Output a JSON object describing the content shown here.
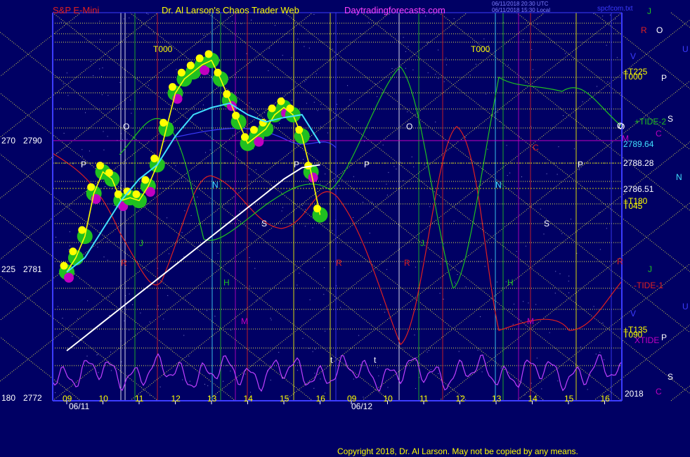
{
  "header": {
    "instrument": "S&P E-Mini",
    "site_title": "Dr. Al Larson's Chaos Trader Web",
    "url": "Daytradingforecasts.com",
    "timestamp1": "06/11/2018 20:30 UTC",
    "timestamp2": "06/11/2018 15:30 Local",
    "filename": "spcfcom.txt"
  },
  "copyright": "Copyright 2018, Dr. Al Larson. May not be copied by any means.",
  "colors": {
    "background": "#000064",
    "axis": "#3c3cff",
    "grid": "#ffff64",
    "price_line": "#ffff00",
    "ema_fast": "#40e0ff",
    "ema_slow": "#ffffff",
    "osc": "#c040ff",
    "red_tide": "#e02020",
    "green_tide": "#20c020",
    "bubble_green": "#20c020",
    "bubble_magenta": "#c000c0"
  },
  "left_axis": {
    "labels": [
      {
        "osc": "270",
        "price": "2790"
      },
      {
        "osc": "225",
        "price": "2781"
      },
      {
        "osc": "180",
        "price": "2772"
      }
    ]
  },
  "right_labels": [
    {
      "text": "J",
      "color": "#20c020"
    },
    {
      "text": "R",
      "color": "#e02020"
    },
    {
      "text": "O",
      "color": "#ffffff"
    },
    {
      "text": "U",
      "color": "#3c3cff"
    },
    {
      "text": "V",
      "color": "#3c3cff"
    },
    {
      "text": "+T225",
      "color": "#ffff00"
    },
    {
      "text": "T000",
      "color": "#ffff00"
    },
    {
      "text": "P",
      "color": "#ffffff"
    },
    {
      "text": "+TIDE-2",
      "color": "#20c020"
    },
    {
      "text": "S",
      "color": "#ffffff"
    },
    {
      "text": "O",
      "color": "#ffffff"
    },
    {
      "text": "C",
      "color": "#c000c0"
    },
    {
      "text": "M",
      "color": "#c000c0"
    },
    {
      "text": "2789.64",
      "color": "#40e0ff"
    },
    {
      "text": "2788.28",
      "color": "#ffffff"
    },
    {
      "text": "N",
      "color": "#40e0ff"
    },
    {
      "text": "2786.51",
      "color": "#ffffff"
    },
    {
      "text": "+T180",
      "color": "#ffff00"
    },
    {
      "text": "T045",
      "color": "#ffff00"
    },
    {
      "text": "R",
      "color": "#e02020"
    },
    {
      "text": "J",
      "color": "#20c020"
    },
    {
      "text": "-TIDE-1",
      "color": "#e02020"
    },
    {
      "text": "U",
      "color": "#3c3cff"
    },
    {
      "text": "V",
      "color": "#3c3cff"
    },
    {
      "text": "+T135",
      "color": "#ffff00"
    },
    {
      "text": "T090",
      "color": "#ffff00"
    },
    {
      "text": "P",
      "color": "#ffffff"
    },
    {
      "text": "XTIDE",
      "color": "#c000c0"
    },
    {
      "text": "S",
      "color": "#ffffff"
    },
    {
      "text": "2018",
      "color": "#ffffff"
    },
    {
      "text": "C",
      "color": "#c000c0"
    }
  ],
  "chart_data": {
    "type": "line",
    "title": "S&P E-Mini",
    "ylabel": "",
    "ylim": [
      2772,
      2797
    ],
    "dates": [
      "06/11",
      "06/12"
    ],
    "hour_ticks": [
      "09",
      "10",
      "11",
      "12",
      "13",
      "14",
      "15",
      "16",
      "09",
      "10",
      "11",
      "12",
      "13",
      "14",
      "15",
      "16"
    ],
    "price_labels": [
      "2790",
      "2781",
      "2772"
    ],
    "oscillator_labels": [
      "270",
      "225",
      "180"
    ],
    "markers": [
      {
        "text": "T000",
        "color": "#ffff00"
      },
      {
        "text": "T000",
        "color": "#ffff00"
      },
      {
        "text": "O",
        "color": "#ffffff"
      },
      {
        "text": "O",
        "color": "#ffffff"
      },
      {
        "text": "O",
        "color": "#ffffff"
      },
      {
        "text": "P",
        "color": "#ffffff"
      },
      {
        "text": "P",
        "color": "#ffffff"
      },
      {
        "text": "P",
        "color": "#ffffff"
      },
      {
        "text": "P",
        "color": "#ffffff"
      },
      {
        "text": "N",
        "color": "#40e0ff"
      },
      {
        "text": "N",
        "color": "#40e0ff"
      },
      {
        "text": "S",
        "color": "#ffffff"
      },
      {
        "text": "S",
        "color": "#ffffff"
      },
      {
        "text": "H",
        "color": "#20c020"
      },
      {
        "text": "H",
        "color": "#20c020"
      },
      {
        "text": "M",
        "color": "#c000c0"
      },
      {
        "text": "M",
        "color": "#c000c0"
      },
      {
        "text": "J",
        "color": "#20c020"
      },
      {
        "text": "J",
        "color": "#20c020"
      },
      {
        "text": "R",
        "color": "#e02020"
      },
      {
        "text": "R",
        "color": "#e02020"
      },
      {
        "text": "R",
        "color": "#e02020"
      },
      {
        "text": "C",
        "color": "#e02020"
      },
      {
        "text": "t",
        "color": "#ffffff"
      },
      {
        "text": "t",
        "color": "#ffffff"
      }
    ],
    "series": [
      {
        "name": "",
        "color": "#ffff00",
        "x": [
          9.0,
          9.25,
          9.5,
          9.75,
          10.0,
          10.25,
          10.5,
          10.75,
          11.0,
          11.25,
          11.5,
          11.75,
          12.0,
          12.25,
          12.5,
          12.75,
          13.0,
          13.25,
          13.5,
          13.75,
          14.0,
          14.25,
          14.5,
          14.75,
          15.0,
          15.25,
          15.5,
          15.75,
          16.0
        ],
        "y": [
          2781.0,
          2782.0,
          2783.5,
          2786.5,
          2788.0,
          2787.5,
          2786.0,
          2786.2,
          2786.0,
          2787.0,
          2788.5,
          2791.0,
          2793.5,
          2794.5,
          2795.0,
          2795.5,
          2795.8,
          2794.5,
          2793.0,
          2791.5,
          2790.0,
          2790.5,
          2791.0,
          2792.0,
          2792.5,
          2792.0,
          2790.5,
          2788.0,
          2785.0
        ]
      },
      {
        "name": "",
        "color": "#40e0ff",
        "x": [
          9.0,
          9.5,
          10.0,
          10.5,
          11.0,
          11.5,
          12.0,
          12.5,
          13.0,
          13.5,
          14.0,
          14.5,
          15.0,
          15.5,
          16.0
        ],
        "y": [
          2781.0,
          2782.0,
          2784.0,
          2786.0,
          2787.5,
          2788.5,
          2790.5,
          2792.0,
          2792.5,
          2792.8,
          2792.0,
          2791.5,
          2791.8,
          2792.0,
          2790.0
        ]
      },
      {
        "name": "",
        "color": "#ffffff",
        "x": [
          9.0,
          9.5,
          10.0,
          10.5,
          11.0,
          11.5,
          12.0,
          12.5,
          13.0,
          13.5,
          14.0,
          14.5,
          15.0,
          15.5,
          16.0
        ],
        "y": [
          2775.5,
          2776.5,
          2777.5,
          2778.5,
          2779.5,
          2780.5,
          2781.5,
          2782.5,
          2783.5,
          2784.5,
          2785.5,
          2786.5,
          2787.5,
          2788.3,
          2788.5
        ]
      }
    ]
  }
}
